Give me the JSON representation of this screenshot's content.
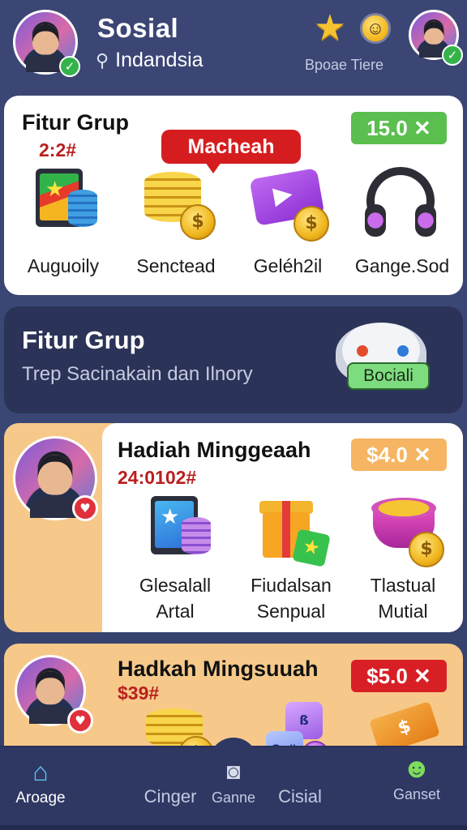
{
  "header": {
    "title": "Sosial",
    "location": "Indandsia",
    "caption": "Bpoae Tiere",
    "icons": [
      "pin-icon",
      "star-icon",
      "smile-icon",
      "check-icon"
    ]
  },
  "card1": {
    "title": "Fitur Grup",
    "code": "2:2#",
    "price": "15.0 ✕",
    "bubble": "Macheah",
    "items": [
      {
        "label": "Auguoily"
      },
      {
        "label": "Senctead"
      },
      {
        "label": "Geléh2il"
      },
      {
        "label": "Gange.Sod"
      }
    ]
  },
  "card2": {
    "title": "Fitur Grup",
    "subtitle": "Trep Sacinakain dan Ilnory",
    "tag": "Bociali"
  },
  "card3": {
    "title": "Hadiah Minggeaah",
    "code": "24:0102#",
    "price": "$4.0 ✕",
    "items": [
      {
        "line1": "Glesalall",
        "line2": "Artal"
      },
      {
        "line1": "Fiudalsan",
        "line2": "Senpual"
      },
      {
        "line1": "Tlastual",
        "line2": "Mutial"
      }
    ]
  },
  "card4": {
    "title": "Hadkah Mingsuuah",
    "code": "$39#",
    "price": "$5.0 ✕"
  },
  "nav": {
    "items": [
      {
        "label": "Aroage",
        "icon": "home-icon"
      },
      {
        "label": "Cinger",
        "icon": ""
      },
      {
        "label": "Ganne",
        "icon": "camera-icon"
      },
      {
        "label": "Cisial",
        "icon": ""
      },
      {
        "label": "Ganset",
        "icon": "chat-icon"
      }
    ]
  },
  "colors": {
    "background": "#3a4673",
    "accent_green": "#5abf4e",
    "accent_red": "#d81f26",
    "accent_orange": "#f6b562",
    "card_orange": "#f6c98a"
  }
}
